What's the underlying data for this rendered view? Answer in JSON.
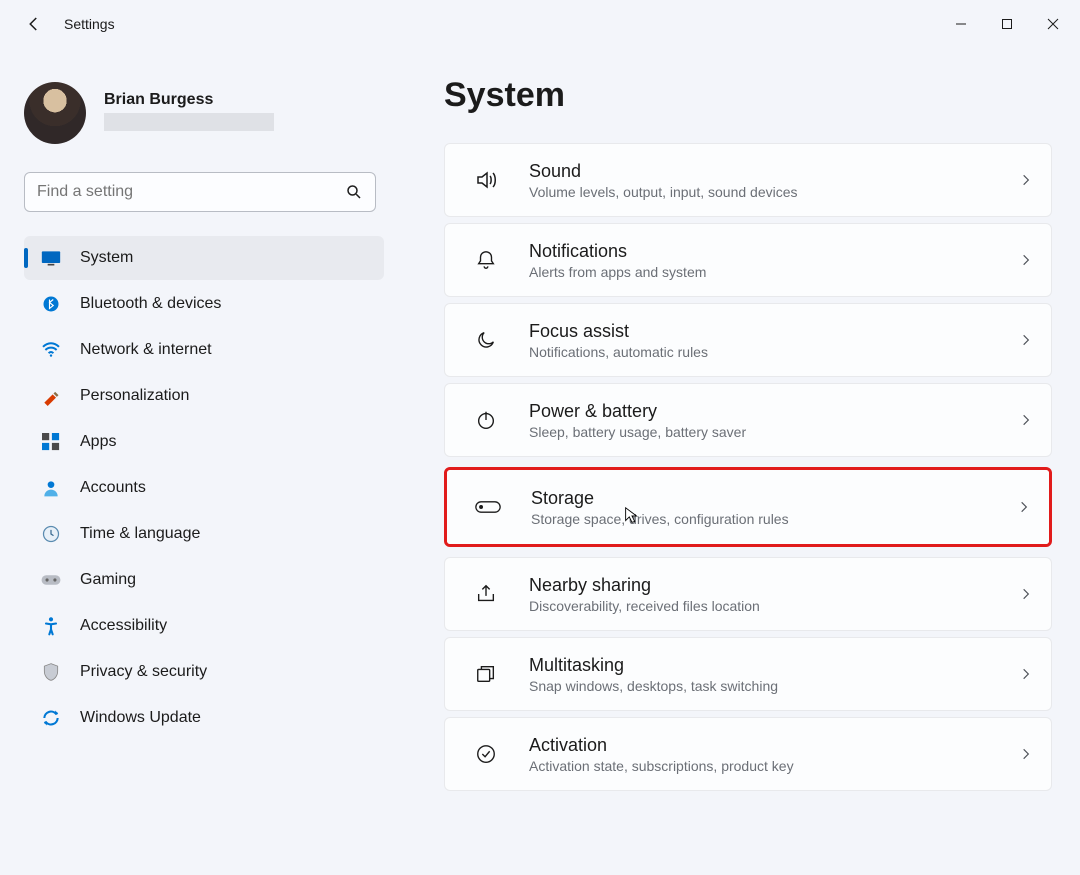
{
  "app_title": "Settings",
  "profile": {
    "name": "Brian Burgess"
  },
  "search": {
    "placeholder": "Find a setting"
  },
  "nav": [
    {
      "id": "system",
      "label": "System",
      "active": true
    },
    {
      "id": "bluetooth",
      "label": "Bluetooth & devices",
      "active": false
    },
    {
      "id": "network",
      "label": "Network & internet",
      "active": false
    },
    {
      "id": "personalization",
      "label": "Personalization",
      "active": false
    },
    {
      "id": "apps",
      "label": "Apps",
      "active": false
    },
    {
      "id": "accounts",
      "label": "Accounts",
      "active": false
    },
    {
      "id": "time",
      "label": "Time & language",
      "active": false
    },
    {
      "id": "gaming",
      "label": "Gaming",
      "active": false
    },
    {
      "id": "accessibility",
      "label": "Accessibility",
      "active": false
    },
    {
      "id": "privacy",
      "label": "Privacy & security",
      "active": false
    },
    {
      "id": "update",
      "label": "Windows Update",
      "active": false
    }
  ],
  "page_title": "System",
  "cards": [
    {
      "id": "sound",
      "title": "Sound",
      "sub": "Volume levels, output, input, sound devices"
    },
    {
      "id": "notifications",
      "title": "Notifications",
      "sub": "Alerts from apps and system"
    },
    {
      "id": "focus",
      "title": "Focus assist",
      "sub": "Notifications, automatic rules"
    },
    {
      "id": "power",
      "title": "Power & battery",
      "sub": "Sleep, battery usage, battery saver"
    },
    {
      "id": "storage",
      "title": "Storage",
      "sub": "Storage space, drives, configuration rules",
      "highlight": true
    },
    {
      "id": "nearby",
      "title": "Nearby sharing",
      "sub": "Discoverability, received files location"
    },
    {
      "id": "multitasking",
      "title": "Multitasking",
      "sub": "Snap windows, desktops, task switching"
    },
    {
      "id": "activation",
      "title": "Activation",
      "sub": "Activation state, subscriptions, product key"
    }
  ]
}
